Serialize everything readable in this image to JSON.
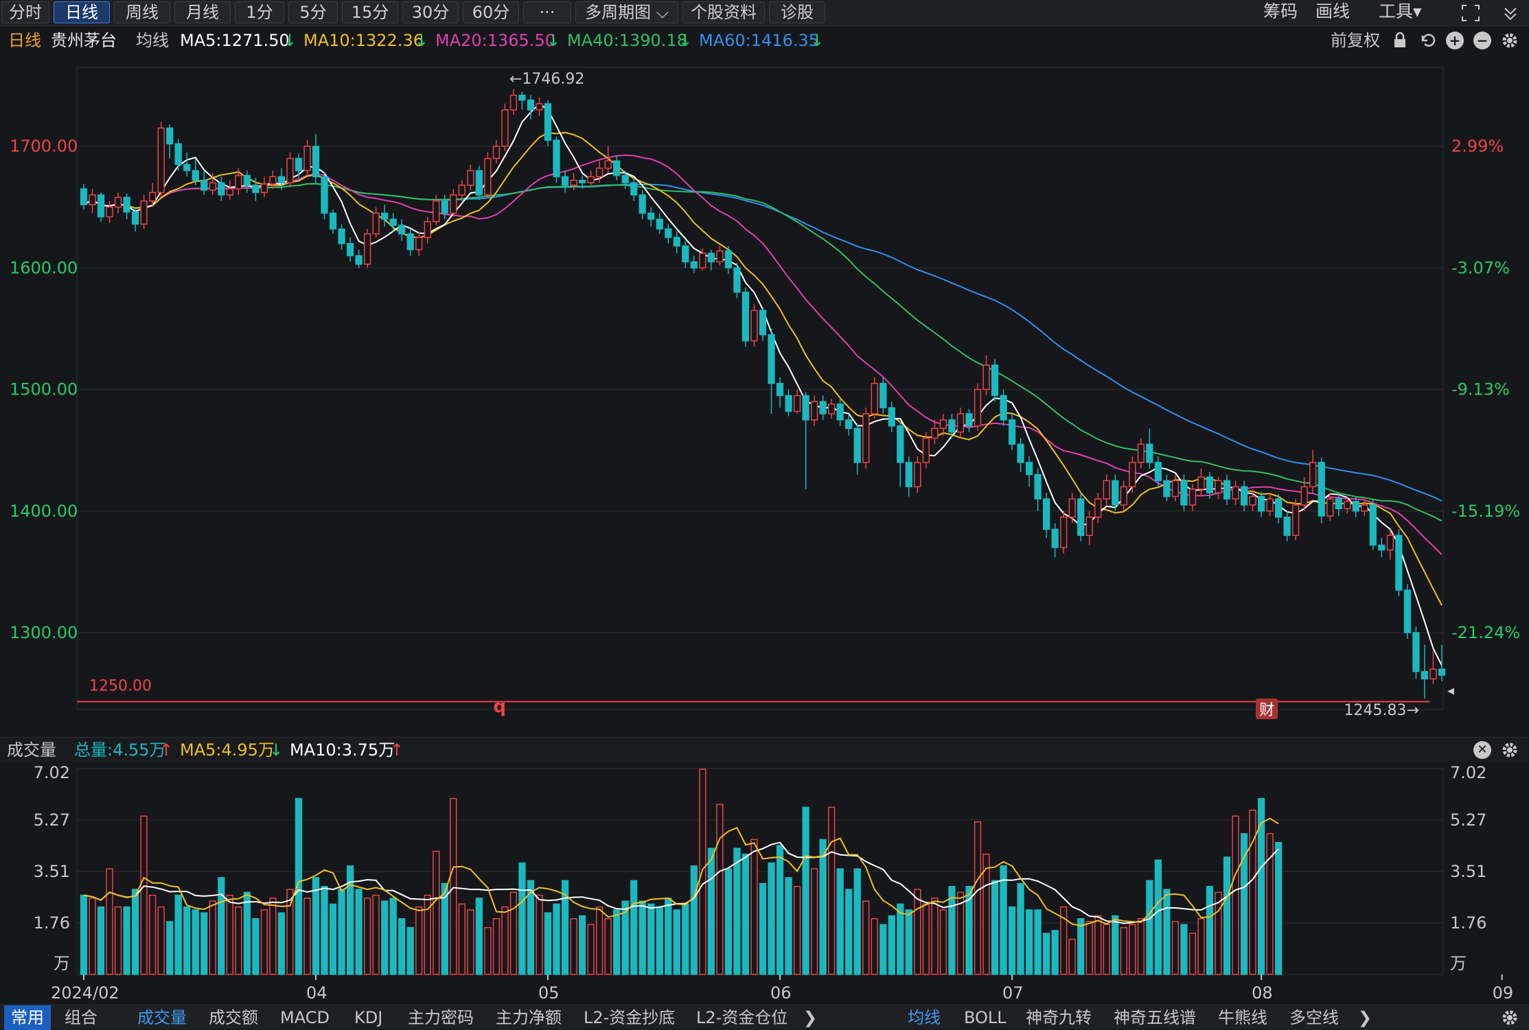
{
  "toolbar": {
    "periods": [
      "分时",
      "日线",
      "周线",
      "月线",
      "1分",
      "5分",
      "15分",
      "30分",
      "60分",
      "···",
      "多周期图 ⌵",
      "个股资料",
      "诊股"
    ],
    "active": "日线",
    "right": [
      "筹码",
      "画线",
      "工具▾"
    ]
  },
  "info": {
    "period": "日线",
    "stock": "贵州茅台",
    "ma_label": "均线",
    "ma5": "MA5:1271.50",
    "ma10": "MA10:1322.36",
    "ma20": "MA20:1365.50",
    "ma40": "MA40:1390.18",
    "ma60": "MA60:1416.35",
    "fq": "前复权"
  },
  "colors": {
    "up": "#ee4444",
    "down": "#1bb8bf",
    "ma5": "#ffffff",
    "ma10": "#f0c020",
    "ma20": "#e040b0",
    "ma40": "#30c060",
    "ma60": "#3090f0",
    "bg": "#16171b",
    "grid": "#2c2d33"
  },
  "annotations": {
    "high": "←1746.92",
    "low": "1245.83→",
    "hline": "1250.00",
    "mark_q": "q",
    "mark_cai": "财"
  },
  "volume_info": {
    "label": "成交量",
    "total": "总量:4.55万",
    "ma5": "MA5:4.95万",
    "ma10": "MA10:3.75万"
  },
  "bottom": {
    "tabs_left": [
      "常用",
      "组合"
    ],
    "tabs_mid": [
      "成交量",
      "成交额",
      "MACD",
      "KDJ",
      "主力密码",
      "主力净额",
      "L2-资金抄底",
      "L2-资金仓位"
    ],
    "tabs_right": [
      "均线",
      "BOLL",
      "神奇九转",
      "神奇五线谱",
      "牛熊线",
      "多空线"
    ]
  },
  "chart_data": {
    "type": "candlestick",
    "price_ticks": [
      "1700.00",
      "1600.00",
      "1500.00",
      "1400.00",
      "1300.00"
    ],
    "price_tick_values": [
      1700,
      1600,
      1500,
      1400,
      1300
    ],
    "pct_ticks": [
      "2.99%",
      "-3.07%",
      "-9.13%",
      "-15.19%",
      "-21.24%"
    ],
    "ylim": [
      1230,
      1765
    ],
    "x_labels": [
      "2024/02",
      "04",
      "05",
      "06",
      "07",
      "08",
      "09"
    ],
    "x_label_index": [
      0,
      27,
      54,
      81,
      108,
      137,
      165
    ],
    "volume_ticks": [
      "7.02",
      "5.27",
      "3.51",
      "1.76",
      "万"
    ],
    "volume_tick_values": [
      7.02,
      5.27,
      3.51,
      1.76,
      0
    ],
    "vol_ylim": [
      0,
      7.02
    ],
    "candles": [
      [
        1665,
        1652,
        1669,
        1648
      ],
      [
        1652,
        1660,
        1665,
        1645
      ],
      [
        1660,
        1642,
        1662,
        1638
      ],
      [
        1642,
        1650,
        1655,
        1637
      ],
      [
        1650,
        1658,
        1662,
        1645
      ],
      [
        1658,
        1646,
        1661,
        1640
      ],
      [
        1646,
        1636,
        1650,
        1630
      ],
      [
        1636,
        1655,
        1660,
        1632
      ],
      [
        1655,
        1662,
        1670,
        1650
      ],
      [
        1662,
        1715,
        1720,
        1658
      ],
      [
        1715,
        1702,
        1718,
        1690
      ],
      [
        1702,
        1685,
        1706,
        1680
      ],
      [
        1685,
        1680,
        1695,
        1675
      ],
      [
        1680,
        1672,
        1690,
        1668
      ],
      [
        1672,
        1664,
        1680,
        1660
      ],
      [
        1664,
        1670,
        1678,
        1660
      ],
      [
        1670,
        1660,
        1675,
        1655
      ],
      [
        1660,
        1665,
        1672,
        1656
      ],
      [
        1665,
        1676,
        1682,
        1660
      ],
      [
        1676,
        1668,
        1680,
        1662
      ],
      [
        1668,
        1662,
        1674,
        1655
      ],
      [
        1662,
        1669,
        1675,
        1658
      ],
      [
        1669,
        1675,
        1680,
        1665
      ],
      [
        1675,
        1670,
        1682,
        1664
      ],
      [
        1670,
        1690,
        1695,
        1666
      ],
      [
        1690,
        1680,
        1694,
        1674
      ],
      [
        1680,
        1700,
        1705,
        1676
      ],
      [
        1700,
        1675,
        1710,
        1670
      ],
      [
        1675,
        1645,
        1678,
        1640
      ],
      [
        1645,
        1632,
        1648,
        1628
      ],
      [
        1632,
        1620,
        1636,
        1615
      ],
      [
        1620,
        1610,
        1625,
        1605
      ],
      [
        1610,
        1603,
        1615,
        1600
      ],
      [
        1603,
        1628,
        1632,
        1600
      ],
      [
        1628,
        1645,
        1650,
        1625
      ],
      [
        1645,
        1640,
        1652,
        1634
      ],
      [
        1640,
        1635,
        1645,
        1630
      ],
      [
        1635,
        1628,
        1640,
        1622
      ],
      [
        1628,
        1615,
        1632,
        1610
      ],
      [
        1615,
        1625,
        1630,
        1610
      ],
      [
        1625,
        1638,
        1642,
        1620
      ],
      [
        1638,
        1655,
        1660,
        1635
      ],
      [
        1655,
        1645,
        1660,
        1640
      ],
      [
        1645,
        1660,
        1665,
        1642
      ],
      [
        1660,
        1668,
        1672,
        1655
      ],
      [
        1668,
        1680,
        1685,
        1664
      ],
      [
        1680,
        1660,
        1684,
        1656
      ],
      [
        1660,
        1690,
        1695,
        1658
      ],
      [
        1690,
        1700,
        1705,
        1686
      ],
      [
        1700,
        1730,
        1735,
        1696
      ],
      [
        1730,
        1742,
        1747,
        1726
      ],
      [
        1742,
        1738,
        1745,
        1730
      ],
      [
        1738,
        1730,
        1742,
        1722
      ],
      [
        1730,
        1735,
        1740,
        1725
      ],
      [
        1735,
        1705,
        1738,
        1700
      ],
      [
        1705,
        1675,
        1708,
        1670
      ],
      [
        1675,
        1668,
        1680,
        1662
      ],
      [
        1668,
        1672,
        1678,
        1664
      ],
      [
        1672,
        1670,
        1676,
        1665
      ],
      [
        1670,
        1675,
        1680,
        1668
      ],
      [
        1675,
        1682,
        1688,
        1670
      ],
      [
        1682,
        1688,
        1700,
        1678
      ],
      [
        1688,
        1676,
        1692,
        1672
      ],
      [
        1676,
        1670,
        1680,
        1665
      ],
      [
        1670,
        1660,
        1674,
        1655
      ],
      [
        1660,
        1645,
        1664,
        1640
      ],
      [
        1645,
        1640,
        1650,
        1634
      ],
      [
        1640,
        1632,
        1645,
        1628
      ],
      [
        1632,
        1625,
        1636,
        1620
      ],
      [
        1625,
        1618,
        1630,
        1612
      ],
      [
        1618,
        1605,
        1622,
        1600
      ],
      [
        1605,
        1600,
        1610,
        1596
      ],
      [
        1600,
        1612,
        1616,
        1598
      ],
      [
        1612,
        1605,
        1615,
        1598
      ],
      [
        1605,
        1614,
        1618,
        1602
      ],
      [
        1614,
        1600,
        1618,
        1595
      ],
      [
        1600,
        1580,
        1604,
        1575
      ],
      [
        1580,
        1540,
        1584,
        1535
      ],
      [
        1540,
        1565,
        1570,
        1535
      ],
      [
        1565,
        1545,
        1568,
        1540
      ],
      [
        1545,
        1505,
        1550,
        1480
      ],
      [
        1505,
        1495,
        1510,
        1485
      ],
      [
        1495,
        1482,
        1500,
        1478
      ],
      [
        1482,
        1495,
        1500,
        1480
      ],
      [
        1495,
        1475,
        1498,
        1418
      ],
      [
        1475,
        1490,
        1495,
        1470
      ],
      [
        1490,
        1480,
        1495,
        1475
      ],
      [
        1480,
        1488,
        1492,
        1476
      ],
      [
        1488,
        1475,
        1492,
        1470
      ],
      [
        1475,
        1468,
        1480,
        1462
      ],
      [
        1468,
        1440,
        1472,
        1430
      ],
      [
        1440,
        1480,
        1485,
        1435
      ],
      [
        1480,
        1505,
        1510,
        1476
      ],
      [
        1505,
        1485,
        1510,
        1480
      ],
      [
        1485,
        1470,
        1490,
        1465
      ],
      [
        1470,
        1440,
        1474,
        1420
      ],
      [
        1440,
        1420,
        1445,
        1412
      ],
      [
        1420,
        1440,
        1445,
        1415
      ],
      [
        1440,
        1460,
        1465,
        1435
      ],
      [
        1460,
        1468,
        1475,
        1455
      ],
      [
        1468,
        1475,
        1480,
        1462
      ],
      [
        1475,
        1465,
        1480,
        1460
      ],
      [
        1465,
        1480,
        1485,
        1460
      ],
      [
        1480,
        1470,
        1484,
        1465
      ],
      [
        1470,
        1500,
        1505,
        1466
      ],
      [
        1500,
        1520,
        1528,
        1495
      ],
      [
        1520,
        1495,
        1525,
        1490
      ],
      [
        1495,
        1475,
        1500,
        1470
      ],
      [
        1475,
        1455,
        1480,
        1450
      ],
      [
        1455,
        1440,
        1460,
        1432
      ],
      [
        1440,
        1430,
        1445,
        1420
      ],
      [
        1430,
        1410,
        1435,
        1400
      ],
      [
        1410,
        1385,
        1415,
        1378
      ],
      [
        1385,
        1370,
        1390,
        1362
      ],
      [
        1370,
        1395,
        1400,
        1365
      ],
      [
        1395,
        1410,
        1415,
        1390
      ],
      [
        1410,
        1380,
        1415,
        1375
      ],
      [
        1380,
        1395,
        1400,
        1372
      ],
      [
        1395,
        1410,
        1415,
        1390
      ],
      [
        1410,
        1425,
        1430,
        1405
      ],
      [
        1425,
        1405,
        1430,
        1400
      ],
      [
        1405,
        1420,
        1425,
        1400
      ],
      [
        1420,
        1440,
        1445,
        1415
      ],
      [
        1440,
        1455,
        1460,
        1435
      ],
      [
        1455,
        1440,
        1468,
        1435
      ],
      [
        1440,
        1425,
        1445,
        1420
      ],
      [
        1425,
        1412,
        1430,
        1408
      ],
      [
        1412,
        1425,
        1430,
        1408
      ],
      [
        1425,
        1405,
        1430,
        1400
      ],
      [
        1405,
        1418,
        1422,
        1400
      ],
      [
        1418,
        1428,
        1435,
        1412
      ],
      [
        1428,
        1415,
        1432,
        1410
      ],
      [
        1415,
        1425,
        1428,
        1410
      ],
      [
        1425,
        1410,
        1430,
        1405
      ],
      [
        1410,
        1420,
        1425,
        1405
      ],
      [
        1420,
        1405,
        1425,
        1400
      ],
      [
        1405,
        1412,
        1418,
        1400
      ],
      [
        1412,
        1400,
        1416,
        1395
      ],
      [
        1400,
        1410,
        1415,
        1396
      ],
      [
        1410,
        1395,
        1414,
        1390
      ],
      [
        1395,
        1380,
        1400,
        1375
      ],
      [
        1380,
        1405,
        1410,
        1376
      ],
      [
        1405,
        1420,
        1428,
        1400
      ],
      [
        1420,
        1440,
        1450,
        1415
      ],
      [
        1440,
        1396,
        1444,
        1390
      ],
      [
        1396,
        1410,
        1415,
        1392
      ],
      [
        1410,
        1402,
        1414,
        1396
      ],
      [
        1402,
        1408,
        1412,
        1398
      ],
      [
        1408,
        1400,
        1412,
        1395
      ],
      [
        1400,
        1405,
        1410,
        1396
      ],
      [
        1405,
        1372,
        1410,
        1368
      ],
      [
        1372,
        1368,
        1378,
        1362
      ],
      [
        1368,
        1380,
        1385,
        1360
      ],
      [
        1380,
        1335,
        1385,
        1330
      ],
      [
        1335,
        1300,
        1340,
        1295
      ],
      [
        1300,
        1268,
        1305,
        1262
      ],
      [
        1268,
        1262,
        1290,
        1245.83
      ],
      [
        1262,
        1270,
        1285,
        1258
      ],
      [
        1270,
        1265,
        1290,
        1260
      ]
    ],
    "volume": [
      2.7,
      2.6,
      2.3,
      3.6,
      2.3,
      2.3,
      2.9,
      5.4,
      2.7,
      2.3,
      1.8,
      2.7,
      2.3,
      2.2,
      2.1,
      2.5,
      3.3,
      2.7,
      2.3,
      2.8,
      1.9,
      2.2,
      2.6,
      2.1,
      2.9,
      6.0,
      2.6,
      3.3,
      3.0,
      2.4,
      2.9,
      3.7,
      2.9,
      2.6,
      2.7,
      2.5,
      2.6,
      1.9,
      1.6,
      2.3,
      2.7,
      4.2,
      3.1,
      6.0,
      2.4,
      2.2,
      2.6,
      1.6,
      1.9,
      2.3,
      2.8,
      3.8,
      3.2,
      2.7,
      2.1,
      2.4,
      3.2,
      1.9,
      2.0,
      1.7,
      2.3,
      1.9,
      2.2,
      2.5,
      3.2,
      2.5,
      2.4,
      2.3,
      2.6,
      2.2,
      2.4,
      3.7,
      7.0,
      4.3,
      5.8,
      3.6,
      4.3,
      4.1,
      4.6,
      3.1,
      3.8,
      4.4,
      3.3,
      3.0,
      5.7,
      3.6,
      4.6,
      5.7,
      3.6,
      2.9,
      3.6,
      2.5,
      1.9,
      1.7,
      2.0,
      2.4,
      2.2,
      2.9,
      2.4,
      2.6,
      2.2,
      3.0,
      2.8,
      3.0,
      5.2,
      4.1,
      3.2,
      3.7,
      2.3,
      3.1,
      2.2,
      2.2,
      1.4,
      1.5,
      2.3,
      1.2,
      1.9,
      1.8,
      2.0,
      1.7,
      2.0,
      1.6,
      1.7,
      1.9,
      3.2,
      3.9,
      2.9,
      1.8,
      1.7,
      1.4,
      1.9,
      3.0,
      2.8,
      4.0,
      5.4,
      4.8,
      5.6,
      6.0,
      4.8,
      4.5
    ]
  }
}
